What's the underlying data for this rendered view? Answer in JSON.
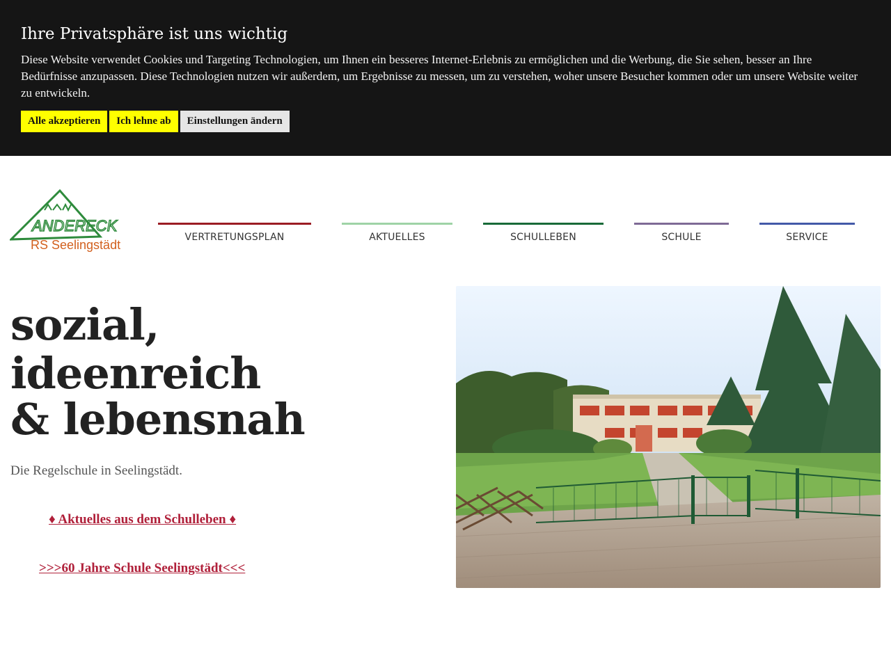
{
  "cookie": {
    "title": "Ihre Privatsphäre ist uns wichtig",
    "text": "Diese Website verwendet Cookies und Targeting Technologien, um Ihnen ein besseres Internet-Erlebnis zu ermöglichen und die Werbung, die Sie sehen, besser an Ihre Bedürfnisse anzupassen. Diese Technologien nutzen wir außerdem, um Ergebnisse zu messen, um zu verstehen, woher unsere Besucher kommen oder um unsere Website weiter zu entwickeln.",
    "accept_label": "Alle akzeptieren",
    "decline_label": "Ich lehne ab",
    "settings_label": "Einstellungen ändern"
  },
  "logo": {
    "brand": "ANDERECK",
    "subtitle": "RS Seelingstädt",
    "green": "#2e8b3c",
    "orange": "#d2601e"
  },
  "nav": {
    "items": [
      {
        "label": "VERTRETUNGSPLAN",
        "color": "#9b1c24"
      },
      {
        "label": "AKTUELLES",
        "color": "#9fd3a6"
      },
      {
        "label": "SCHULLEBEN",
        "color": "#186a38"
      },
      {
        "label": "SCHULE",
        "color": "#7e6a95"
      },
      {
        "label": "SERVICE",
        "color": "#4359a8"
      }
    ]
  },
  "hero": {
    "line1": "sozial,",
    "line2": "ideenreich",
    "line3": "& lebensnah",
    "subtitle": "Die Regelschule in Seelingstädt.",
    "link1": "♦ Aktuelles aus dem Schulleben ♦",
    "link2": ">>>60 Jahre Schule Seelingstädt<<<"
  },
  "colors": {
    "banner_bg": "#151515",
    "button_yellow": "#ffff00",
    "link": "#b0203a"
  }
}
